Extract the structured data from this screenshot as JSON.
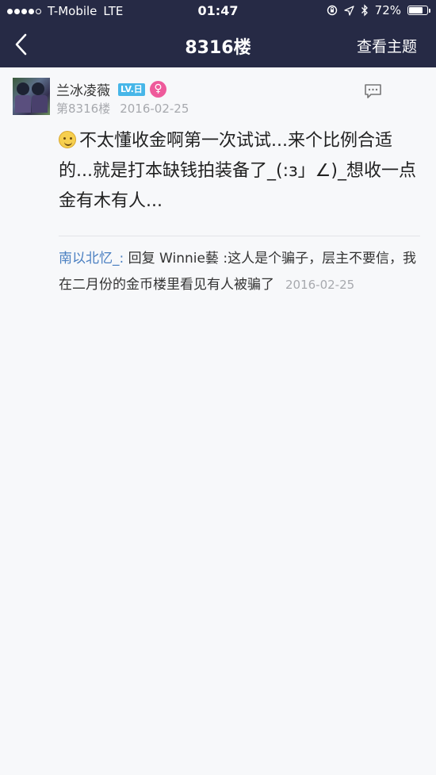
{
  "status_bar": {
    "carrier": "T-Mobile",
    "network": "LTE",
    "time": "01:47",
    "battery": "72%",
    "battery_level": 0.72,
    "icons": [
      "signal-dots",
      "orientation-lock-icon",
      "location-icon",
      "bluetooth-icon",
      "battery-icon"
    ]
  },
  "nav": {
    "title": "8316楼",
    "view_topic": "查看主题",
    "back_icon": "chevron-left-icon"
  },
  "post": {
    "username": "兰冰凌薇",
    "level_badge": "LV.日",
    "gender_symbol": "♀",
    "floor": "第8316楼",
    "date": "2016-02-25",
    "content": "不太懂收金啊第一次试试...来个比例合适的...就是打本缺钱拍装备了_(:з」∠)_想收一点金有木有人...",
    "emoji_icon": "shushing-face-emoji",
    "comment_icon": "comment-bubble-icon"
  },
  "reply": {
    "author": "南以北忆_:",
    "text": " 回复 Winnie藝 :这人是个骗子，层主不要信，我在二月份的金币楼里看见有人被骗了",
    "date": "2016-02-25"
  },
  "colors": {
    "nav_bg": "#262a45",
    "page_bg": "#f7f8fa",
    "badge": "#47b6e8",
    "female": "#ee5a9b",
    "link": "#4a7fc1"
  }
}
